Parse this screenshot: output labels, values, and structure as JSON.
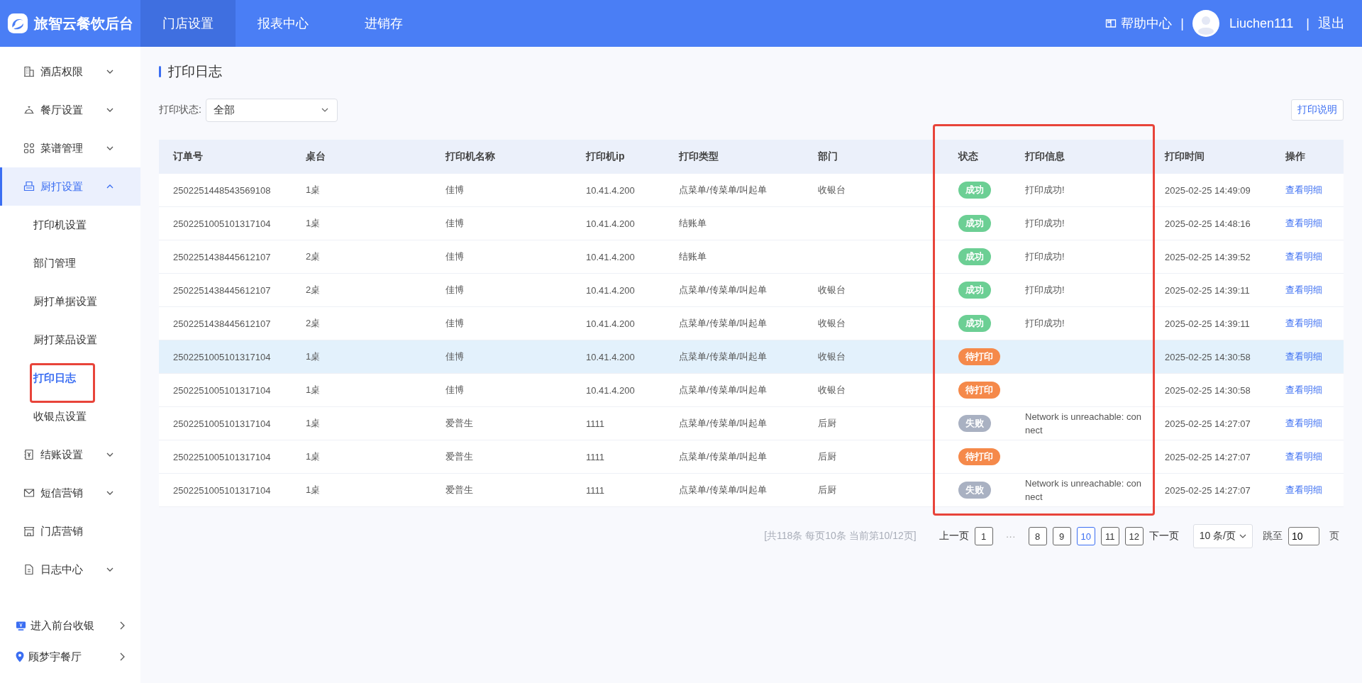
{
  "header": {
    "logo_text": "旅智云餐饮后台",
    "nav": [
      {
        "label": "门店设置",
        "selected": true
      },
      {
        "label": "报表中心",
        "selected": false
      },
      {
        "label": "进销存",
        "selected": false
      }
    ],
    "help": "帮助中心",
    "separator_1": "|",
    "user": "Liuchen111",
    "separator_2": "|",
    "logout": "退出"
  },
  "sidebar": {
    "items": [
      {
        "kind": "building",
        "label": "酒店权限",
        "expanded": false,
        "selected": false
      },
      {
        "kind": "bell",
        "label": "餐厅设置",
        "expanded": false,
        "selected": false
      },
      {
        "kind": "grid",
        "label": "菜谱管理",
        "expanded": false,
        "selected": false
      },
      {
        "kind": "printer",
        "label": "厨打设置",
        "expanded": true,
        "selected": true,
        "children": [
          {
            "label": "打印机设置",
            "selected": false,
            "highlighted": false
          },
          {
            "label": "部门管理",
            "selected": false,
            "highlighted": false
          },
          {
            "label": "厨打单据设置",
            "selected": false,
            "highlighted": false
          },
          {
            "label": "厨打菜品设置",
            "selected": false,
            "highlighted": false
          },
          {
            "label": "打印日志",
            "selected": true,
            "highlighted": true
          },
          {
            "label": "收银点设置",
            "selected": false,
            "highlighted": false
          }
        ]
      },
      {
        "kind": "receipt",
        "label": "结账设置",
        "expanded": false,
        "selected": false
      },
      {
        "kind": "mail",
        "label": "短信营销",
        "expanded": false,
        "selected": false
      },
      {
        "kind": "store",
        "label": "门店营销",
        "selected": false
      },
      {
        "kind": "document",
        "label": "日志中心",
        "expanded": false,
        "selected": false
      }
    ],
    "bottom_links": [
      {
        "kind": "monitor",
        "label": "进入前台收银"
      },
      {
        "kind": "pin",
        "label": "顾梦宇餐厅"
      }
    ]
  },
  "page_title": "打印日志",
  "filter": {
    "label": "打印状态:",
    "value": "全部"
  },
  "help_button": "打印说明",
  "table": {
    "columns": [
      {
        "label": "订单号"
      },
      {
        "label": "桌台"
      },
      {
        "label": "打印机名称"
      },
      {
        "label": "打印机ip"
      },
      {
        "label": "打印类型"
      },
      {
        "label": "部门"
      },
      {
        "label": "状态",
        "highlighted": true
      },
      {
        "label": "打印信息",
        "highlighted": true
      },
      {
        "label": "打印时间"
      },
      {
        "label": "操作"
      }
    ],
    "rows": [
      {
        "selected": false,
        "order_no": "2502251448543569108",
        "table": "1桌",
        "printer_name": "佳博",
        "printer_ip": "10.41.4.200",
        "print_type": "点菜单/传菜单/叫起单",
        "department": "收银台",
        "status": {
          "label": "成功",
          "kind": "success"
        },
        "info": "打印成功!",
        "time": "2025-02-25 14:49:09",
        "action": "查看明细"
      },
      {
        "selected": false,
        "order_no": "2502251005101317104",
        "table": "1桌",
        "printer_name": "佳博",
        "printer_ip": "10.41.4.200",
        "print_type": "结账单",
        "status": {
          "label": "成功",
          "kind": "success"
        },
        "info": "打印成功!",
        "time": "2025-02-25 14:48:16",
        "action": "查看明细"
      },
      {
        "selected": false,
        "order_no": "2502251438445612107",
        "table": "2桌",
        "printer_name": "佳博",
        "printer_ip": "10.41.4.200",
        "print_type": "结账单",
        "status": {
          "label": "成功",
          "kind": "success"
        },
        "info": "打印成功!",
        "time": "2025-02-25 14:39:52",
        "action": "查看明细"
      },
      {
        "selected": false,
        "order_no": "2502251438445612107",
        "table": "2桌",
        "printer_name": "佳博",
        "printer_ip": "10.41.4.200",
        "print_type": "点菜单/传菜单/叫起单",
        "department": "收银台",
        "status": {
          "label": "成功",
          "kind": "success"
        },
        "info": "打印成功!",
        "time": "2025-02-25 14:39:11",
        "action": "查看明细"
      },
      {
        "selected": false,
        "order_no": "2502251438445612107",
        "table": "2桌",
        "printer_name": "佳博",
        "printer_ip": "10.41.4.200",
        "print_type": "点菜单/传菜单/叫起单",
        "department": "收银台",
        "status": {
          "label": "成功",
          "kind": "success"
        },
        "info": "打印成功!",
        "time": "2025-02-25 14:39:11",
        "action": "查看明细"
      },
      {
        "selected": true,
        "order_no": "2502251005101317104",
        "table": "1桌",
        "printer_name": "佳博",
        "printer_ip": "10.41.4.200",
        "print_type": "点菜单/传菜单/叫起单",
        "department": "收银台",
        "status": {
          "label": "待打印",
          "kind": "pending"
        },
        "time": "2025-02-25 14:30:58",
        "action": "查看明细"
      },
      {
        "selected": false,
        "order_no": "2502251005101317104",
        "table": "1桌",
        "printer_name": "佳博",
        "printer_ip": "10.41.4.200",
        "print_type": "点菜单/传菜单/叫起单",
        "department": "收银台",
        "status": {
          "label": "待打印",
          "kind": "pending"
        },
        "time": "2025-02-25 14:30:58",
        "action": "查看明细"
      },
      {
        "selected": false,
        "order_no": "2502251005101317104",
        "table": "1桌",
        "printer_name": "爱普生",
        "printer_ip": "1111",
        "print_type": "点菜单/传菜单/叫起单",
        "department": "后厨",
        "status": {
          "label": "失败",
          "kind": "failed"
        },
        "info": "Network is unreachable: connect",
        "time": "2025-02-25 14:27:07",
        "action": "查看明细"
      },
      {
        "selected": false,
        "order_no": "2502251005101317104",
        "table": "1桌",
        "printer_name": "爱普生",
        "printer_ip": "1111",
        "print_type": "点菜单/传菜单/叫起单",
        "department": "后厨",
        "status": {
          "label": "待打印",
          "kind": "pending"
        },
        "time": "2025-02-25 14:27:07",
        "action": "查看明细"
      },
      {
        "selected": false,
        "order_no": "2502251005101317104",
        "table": "1桌",
        "printer_name": "爱普生",
        "printer_ip": "1111",
        "print_type": "点菜单/传菜单/叫起单",
        "department": "后厨",
        "status": {
          "label": "失败",
          "kind": "failed"
        },
        "info": "Network is unreachable: connect",
        "time": "2025-02-25 14:27:07",
        "action": "查看明细"
      }
    ]
  },
  "pagination": {
    "summary": "[共118条 每页10条 当前第10/12页]",
    "prev": "上一页",
    "pages": [
      {
        "label": "1",
        "selected": false
      },
      {
        "label": "8",
        "selected": false
      },
      {
        "label": "9",
        "selected": false
      },
      {
        "label": "10",
        "selected": true
      },
      {
        "label": "11",
        "selected": false
      },
      {
        "label": "12",
        "selected": false
      }
    ],
    "ellipsis": "···",
    "next": "下一页",
    "page_size": "10 条/页",
    "jump_label": "跳至",
    "jump_value": "10",
    "jump_suffix": "页"
  }
}
